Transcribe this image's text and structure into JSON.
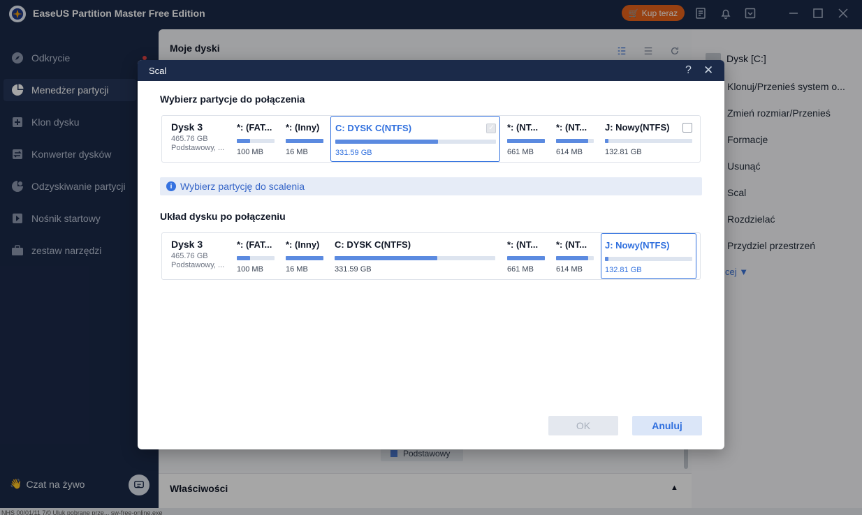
{
  "app": {
    "title": "EaseUS Partition Master Free Edition",
    "buy_label": "Kup teraz"
  },
  "sidebar": {
    "items": [
      {
        "label": "Odkrycie",
        "icon": "compass-icon"
      },
      {
        "label": "Menedżer partycji",
        "icon": "pie-chart-icon",
        "active": true
      },
      {
        "label": "Klon dysku",
        "icon": "clone-icon"
      },
      {
        "label": "Konwerter dysków",
        "icon": "convert-icon"
      },
      {
        "label": "Odzyskiwanie partycji",
        "icon": "recovery-icon"
      },
      {
        "label": "Nośnik startowy",
        "icon": "boot-media-icon"
      },
      {
        "label": "zestaw narzędzi",
        "icon": "toolbox-icon"
      }
    ],
    "chat_label": "Czat na żywo"
  },
  "main": {
    "title": "Moje dyski",
    "legend": "Podstawowy",
    "properties_title": "Właściwości"
  },
  "right_panel": {
    "drive": "Dysk [C:]",
    "operations": [
      "Klonuj/Przenieś system o...",
      "Zmień rozmiar/Przenieś",
      "Formacje",
      "Usunąć",
      "Scal",
      "Rozdzielać",
      "Przydziel przestrzeń"
    ],
    "more": "cej ▼"
  },
  "dialog": {
    "title": "Scal",
    "help": "?",
    "close": "✕",
    "select_title": "Wybierz partycje do połączenia",
    "info": "Wybierz partycję do scalenia",
    "layout_title": "Układ dysku po połączeniu",
    "ok_label": "OK",
    "cancel_label": "Anuluj",
    "disk": {
      "name": "Dysk 3",
      "size": "465.76 GB",
      "type": "Podstawowy, ..."
    },
    "partitions": [
      {
        "name": "*: (FAT...",
        "size": "100 MB",
        "used": 0.35
      },
      {
        "name": "*: (Inny)",
        "size": "16 MB",
        "used": 1.0
      },
      {
        "name": "C: DYSK C(NTFS)",
        "size": "331.59 GB",
        "used": 0.64
      },
      {
        "name": "*: (NT...",
        "size": "661 MB",
        "used": 1.0
      },
      {
        "name": "*: (NT...",
        "size": "614 MB",
        "used": 0.85
      },
      {
        "name": "J: Nowy(NTFS)",
        "size": "132.81 GB",
        "used": 0.04
      }
    ]
  },
  "taskbar_text": "NHS 00/01/11 7/0 Uluk pobrane prze... sw-free-online.exe"
}
